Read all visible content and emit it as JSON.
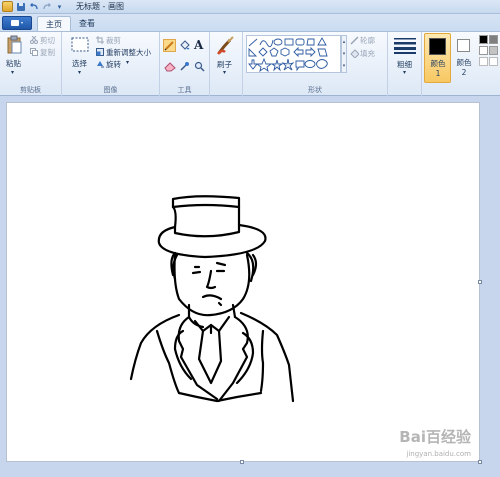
{
  "title_bar": {
    "title": "无标题 - 画图"
  },
  "tabs": {
    "file_label": "",
    "items": [
      {
        "label": "主页",
        "active": true
      },
      {
        "label": "查看",
        "active": false
      }
    ]
  },
  "ribbon": {
    "clipboard": {
      "group_label": "剪贴板",
      "paste": "粘贴",
      "cut": "剪切",
      "copy": "复制"
    },
    "image": {
      "group_label": "图像",
      "select": "选择",
      "crop": "裁剪",
      "resize": "重新调整大小",
      "rotate": "旋转"
    },
    "tools": {
      "group_label": "工具",
      "tool_icons": [
        "pencil-icon",
        "fill-icon",
        "text-icon",
        "eraser-icon",
        "color-picker-icon",
        "magnifier-icon"
      ]
    },
    "brushes": {
      "label": "刷子"
    },
    "shapes": {
      "group_label": "形状",
      "outline": "轮廓",
      "fill": "填充"
    },
    "size": {
      "label": "粗细"
    },
    "colors": {
      "color1_label": "颜色 1",
      "color2_label": "颜色 2",
      "color1": "#000000",
      "color2": "#ffffff"
    }
  },
  "watermark": {
    "text": "Bai百经验",
    "url": "jingyan.baidu.com"
  }
}
